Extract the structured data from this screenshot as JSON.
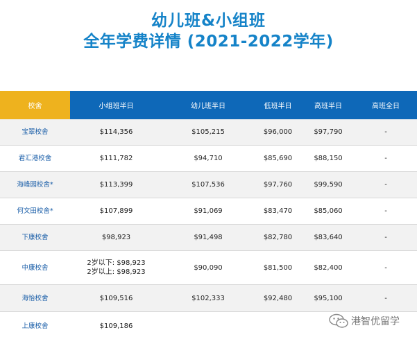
{
  "title": {
    "line1": "幼儿班&小组班",
    "line2": "全年学费详情 (2021-2022学年)"
  },
  "table": {
    "headers": [
      "校舍",
      "小组班半日",
      "幼儿班半日",
      "低班半日",
      "高班半日",
      "高班全日"
    ],
    "rows": [
      {
        "campus": "宝翠校舍",
        "small_group": "$114,356",
        "nursery": "$105,215",
        "lower": "$96,000",
        "upper": "$97,790",
        "upper_full": "-"
      },
      {
        "campus": "君汇港校舍",
        "small_group": "$111,782",
        "nursery": "$94,710",
        "lower": "$85,690",
        "upper": "$88,150",
        "upper_full": "-"
      },
      {
        "campus": "海峰园校舍*",
        "small_group": "$113,399",
        "nursery": "$107,536",
        "lower": "$97,760",
        "upper": "$99,590",
        "upper_full": "-"
      },
      {
        "campus": "何文田校舍*",
        "small_group": "$107,899",
        "nursery": "$91,069",
        "lower": "$83,470",
        "upper": "$85,060",
        "upper_full": "-"
      },
      {
        "campus": "下康校舍",
        "small_group": "$98,923",
        "nursery": "$91,498",
        "lower": "$82,780",
        "upper": "$83,640",
        "upper_full": "-"
      },
      {
        "campus": "中康校舍",
        "small_group_line1": "2岁以下: $98,923",
        "small_group_line2": "2岁以上: $98,923",
        "nursery": "$90,090",
        "lower": "$81,500",
        "upper": "$82,400",
        "upper_full": "-"
      },
      {
        "campus": "海怡校舍",
        "small_group": "$109,516",
        "nursery": "$102,333",
        "lower": "$92,480",
        "upper": "$95,100",
        "upper_full": "-"
      },
      {
        "campus": "上康校舍",
        "small_group": "$109,186",
        "nursery": "",
        "lower": "",
        "upper": "",
        "upper_full": ""
      }
    ]
  },
  "watermark": {
    "text": "港智优留学"
  }
}
